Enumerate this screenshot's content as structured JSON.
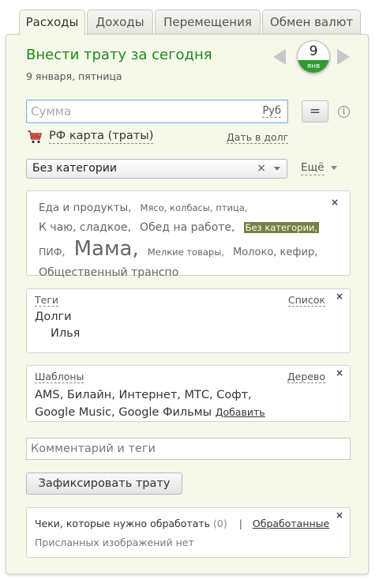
{
  "tabs": [
    {
      "label": "Расходы",
      "active": true
    },
    {
      "label": "Доходы",
      "active": false
    },
    {
      "label": "Перемещения",
      "active": false
    },
    {
      "label": "Обмен валют",
      "active": false
    }
  ],
  "header": {
    "title": "Внести трату за сегодня",
    "date_text": "9 января, пятница",
    "day": "9",
    "month": "янв"
  },
  "amount": {
    "placeholder": "Сумма",
    "currency": "Руб"
  },
  "controls": {
    "calc_label": "=",
    "info_label": "i"
  },
  "account": {
    "name": "РФ карта (траты)",
    "loan_link": "Дать в долг"
  },
  "category": {
    "selected": "Без категории",
    "clear": "×",
    "more_label": "Ещё"
  },
  "cloud": {
    "close": "×",
    "items": [
      {
        "label": "Еда и продукты,",
        "size": 13.5
      },
      {
        "label": "Мясо, колбасы, птица,",
        "size": 11.5
      },
      {
        "label": "К чаю, сладкое,",
        "size": 14
      },
      {
        "label": "Обед на работе,",
        "size": 14
      },
      {
        "label": "Без категории,",
        "size": 11.5,
        "selected": true
      },
      {
        "label": "ПИФ,",
        "size": 12.5
      },
      {
        "label": "Мама,",
        "size": 26
      },
      {
        "label": "Мелкие товары,",
        "size": 11.5
      },
      {
        "label": "Молоко, кефир,",
        "size": 13
      },
      {
        "label": "Общественный транспо",
        "size": 14
      }
    ]
  },
  "tags": {
    "header": "Теги",
    "view_link": "Список",
    "close": "×",
    "items": [
      "Долги",
      "Илья"
    ]
  },
  "templates": {
    "header": "Шаблоны",
    "view_link": "Дерево",
    "close": "×",
    "items": [
      "AMS,",
      "Билайн,",
      "Интернет,",
      "МТС,",
      "Софт,",
      "Google Music,",
      "Google Фильмы"
    ],
    "add_label": "Добавить"
  },
  "comment": {
    "placeholder": "Комментарий и теги"
  },
  "submit_label": "Зафиксировать трату",
  "receipts": {
    "text": "Чеки, которые нужно обработать",
    "count": "(0)",
    "separator": "|",
    "processed_link": "Обработанные",
    "no_images": "Присланных изображений нет",
    "close": "×"
  },
  "colors": {
    "title": "#1c8a1c",
    "month_badge": "#2f9a2f",
    "panel_bg": "#f6f9ea",
    "selected_tag_bg": "#7a7d44"
  }
}
